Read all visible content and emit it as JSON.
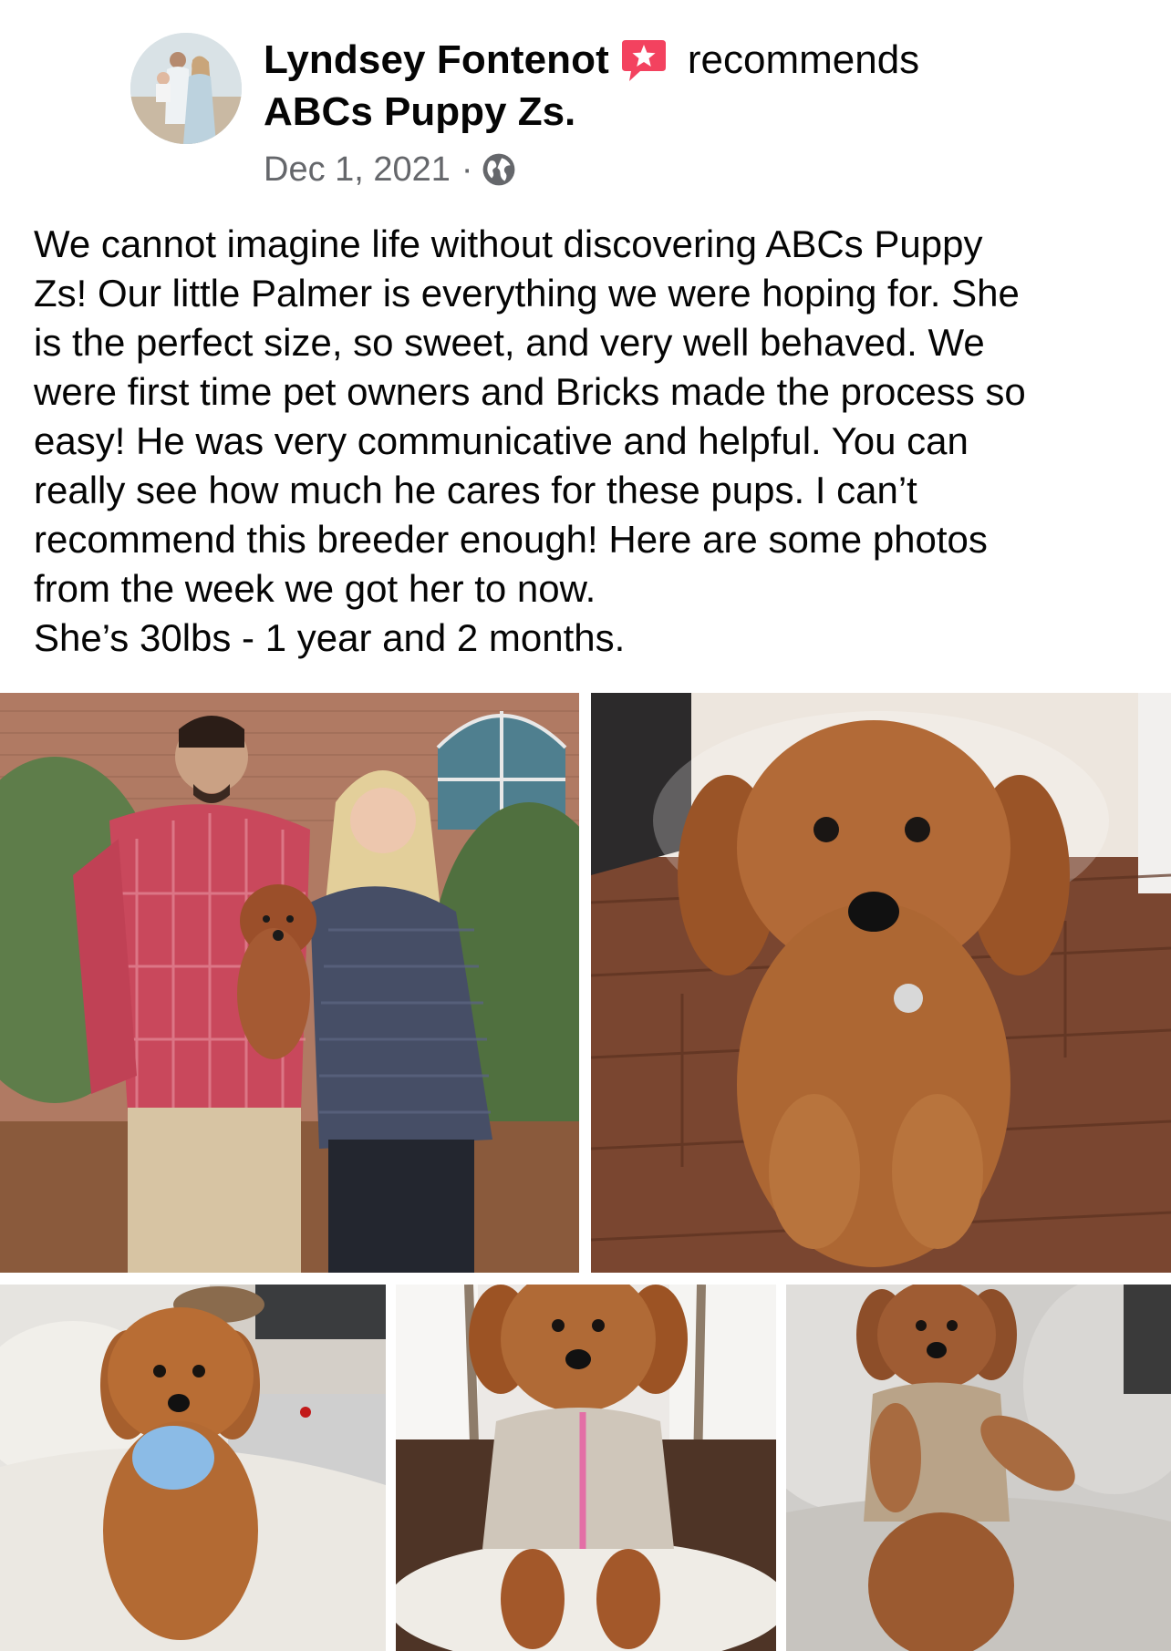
{
  "post": {
    "author_name": "Lyndsey Fontenot",
    "recommend_verb": "recommends",
    "page_name": "ABCs Puppy Zs.",
    "date": "Dec 1, 2021",
    "separator": "·",
    "audience_icon": "globe-icon",
    "badge_icon": "recommend-star-icon",
    "badge_color": "#f3425f",
    "text_lines": [
      "We cannot imagine life without discovering ABCs Puppy",
      "Zs! Our little Palmer is everything we were hoping for. She",
      "is the perfect size, so sweet, and very well behaved. We",
      "were first time pet owners and Bricks made the process so",
      "easy! He was very communicative and helpful. You can",
      "really see how much he cares for these pups. I can’t",
      "recommend this breeder enough! Here are some photos",
      "from the week we got her to now.",
      "She’s 30lbs - 1 year and 2 months."
    ]
  },
  "colors": {
    "text_primary": "#050505",
    "text_secondary": "#65676b",
    "background": "#ffffff"
  }
}
